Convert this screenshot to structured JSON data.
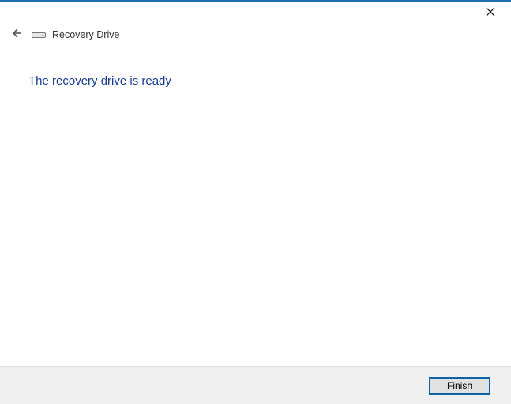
{
  "window": {
    "title": "Recovery Drive"
  },
  "content": {
    "heading": "The recovery drive is ready"
  },
  "footer": {
    "finish_label": "Finish"
  }
}
